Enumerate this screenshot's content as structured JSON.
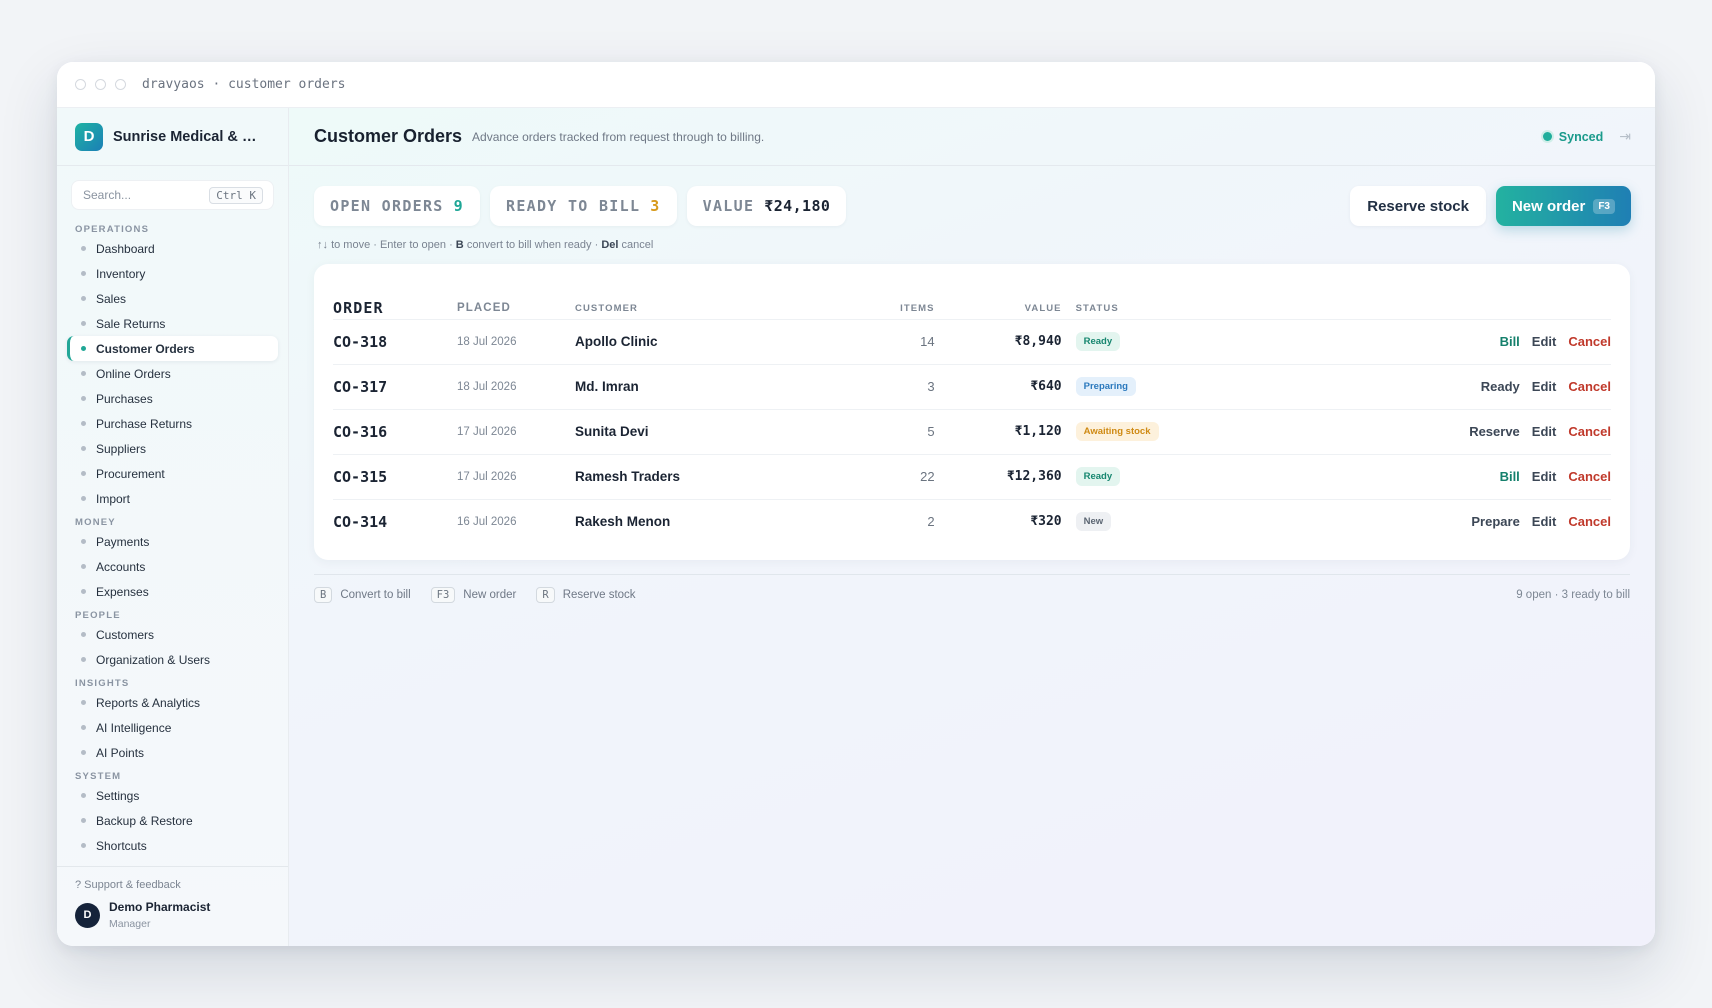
{
  "window": {
    "title": "dravyaos · customer orders"
  },
  "sidebar": {
    "brand_initial": "D",
    "brand_name": "Sunrise Medical & Ge...",
    "search_placeholder": "Search...",
    "search_shortcut": "Ctrl K",
    "sections": [
      {
        "label": "OPERATIONS",
        "items": [
          "Dashboard",
          "Inventory",
          "Sales",
          "Sale Returns",
          "Customer Orders",
          "Online Orders",
          "Purchases",
          "Purchase Returns",
          "Suppliers",
          "Procurement",
          "Import"
        ]
      },
      {
        "label": "MONEY",
        "items": [
          "Payments",
          "Accounts",
          "Expenses"
        ]
      },
      {
        "label": "PEOPLE",
        "items": [
          "Customers",
          "Organization & Users"
        ]
      },
      {
        "label": "INSIGHTS",
        "items": [
          "Reports & Analytics",
          "AI Intelligence",
          "AI Points"
        ]
      },
      {
        "label": "SYSTEM",
        "items": [
          "Settings",
          "Backup & Restore",
          "Shortcuts"
        ]
      }
    ],
    "active_item": "Customer Orders",
    "support": "? Support & feedback",
    "user": {
      "initial": "D",
      "name": "Demo Pharmacist",
      "role": "Manager"
    }
  },
  "header": {
    "title": "Customer Orders",
    "subtitle": "Advance orders tracked from request through to billing.",
    "sync_status": "Synced"
  },
  "stats": [
    {
      "label": "OPEN ORDERS",
      "value": "9",
      "color": "#1ea696"
    },
    {
      "label": "READY TO BILL",
      "value": "3",
      "color": "#d79a1c"
    },
    {
      "label": "VALUE",
      "value": "₹24,180",
      "color": "#1b2433"
    }
  ],
  "buttons": {
    "reserve": "Reserve stock",
    "new_order": "New order",
    "new_order_key": "F3"
  },
  "hint": {
    "arrows": "↑↓",
    "move": "to move · Enter to open ·",
    "b_key": "B",
    "convert": "convert to bill when ready ·",
    "del_key": "Del",
    "cancel": "cancel"
  },
  "table": {
    "columns": [
      "ORDER",
      "PLACED",
      "CUSTOMER",
      "ITEMS",
      "VALUE",
      "STATUS"
    ],
    "rows": [
      {
        "order": "CO-318",
        "placed": "18 Jul 2026",
        "customer": "Apollo Clinic",
        "items": "14",
        "value": "₹8,940",
        "status": "Ready",
        "status_kind": "ready",
        "primary_action": "Bill",
        "primary_kind": "primary",
        "edit": "Edit",
        "cancel": "Cancel"
      },
      {
        "order": "CO-317",
        "placed": "18 Jul 2026",
        "customer": "Md. Imran",
        "items": "3",
        "value": "₹640",
        "status": "Preparing",
        "status_kind": "preparing",
        "primary_action": "Ready",
        "primary_kind": "neutral",
        "edit": "Edit",
        "cancel": "Cancel"
      },
      {
        "order": "CO-316",
        "placed": "17 Jul 2026",
        "customer": "Sunita Devi",
        "items": "5",
        "value": "₹1,120",
        "status": "Awaiting stock",
        "status_kind": "awaiting",
        "primary_action": "Reserve",
        "primary_kind": "neutral",
        "edit": "Edit",
        "cancel": "Cancel"
      },
      {
        "order": "CO-315",
        "placed": "17 Jul 2026",
        "customer": "Ramesh Traders",
        "items": "22",
        "value": "₹12,360",
        "status": "Ready",
        "status_kind": "ready",
        "primary_action": "Bill",
        "primary_kind": "primary",
        "edit": "Edit",
        "cancel": "Cancel"
      },
      {
        "order": "CO-314",
        "placed": "16 Jul 2026",
        "customer": "Rakesh Menon",
        "items": "2",
        "value": "₹320",
        "status": "New",
        "status_kind": "new",
        "primary_action": "Prepare",
        "primary_kind": "neutral",
        "edit": "Edit",
        "cancel": "Cancel"
      }
    ]
  },
  "footer": {
    "shortcuts": [
      {
        "key": "B",
        "label": "Convert to bill"
      },
      {
        "key": "F3",
        "label": "New order"
      },
      {
        "key": "R",
        "label": "Reserve stock"
      }
    ],
    "status": "9 open · 3 ready to bill"
  },
  "colors": {
    "accent": "#1ea696",
    "brand_gradient_end": "#1f7fb4",
    "cancel": "#c0392b"
  }
}
